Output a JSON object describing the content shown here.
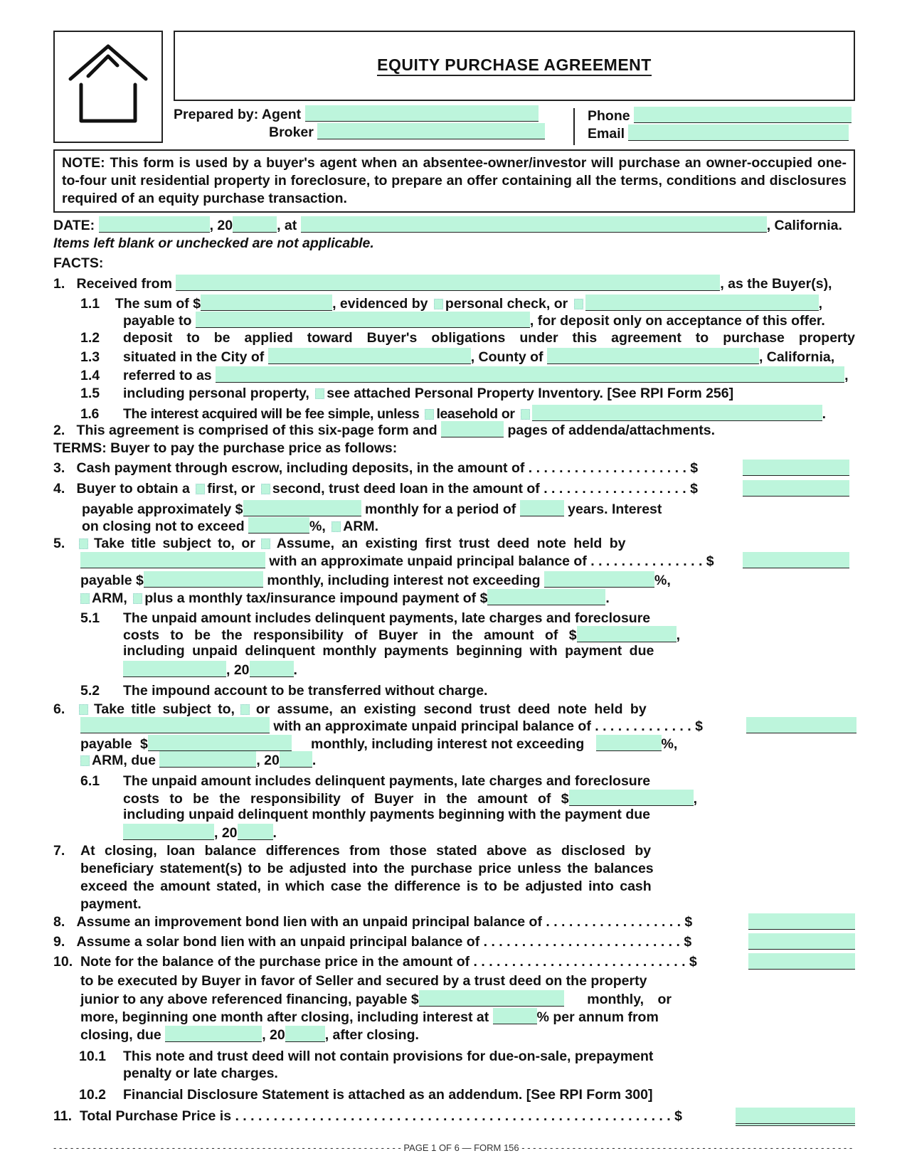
{
  "header": {
    "logo_icon": "house-icon",
    "title": "EQUITY PURCHASE AGREEMENT",
    "prepared_by_agent_label": "Prepared by: Agent",
    "broker_label": "Broker",
    "phone_label": "Phone",
    "email_label": "Email"
  },
  "note": "NOTE: This form is used by a buyer's agent when an absentee-owner/investor will purchase an owner-occupied one-to-four unit residential property in foreclosure, to prepare an offer containing all the terms, conditions and disclosures required of an equity purchase transaction.",
  "date_line": {
    "date_label": "DATE:",
    "year_prefix": ", 20",
    "at_label": ", at",
    "state": ", California."
  },
  "blank_notice": "Items left blank or unchecked are not applicable.",
  "facts_heading": "FACTS:",
  "items": {
    "i1": {
      "num": "1.",
      "text": "Received from",
      "suffix": ", as the Buyer(s),"
    },
    "i1_1": {
      "num": "1.1",
      "a": "The sum of $",
      "b": ", evidenced by",
      "c": "personal check, or",
      "d": ","
    },
    "i1_1b": {
      "a": "payable to",
      "b": ", for deposit only on acceptance of this offer."
    },
    "i1_2": {
      "num": "1.2",
      "text": "deposit to be applied toward Buyer's obligations under this agreement to purchase property"
    },
    "i1_3": {
      "num": "1.3",
      "a": "situated in the City of",
      "b": ", County of",
      "c": ", California,"
    },
    "i1_4": {
      "num": "1.4",
      "a": "referred to as",
      "b": ","
    },
    "i1_5": {
      "num": "1.5",
      "a": "including personal property,",
      "b": "see attached Personal Property Inventory. [See RPI Form 256]"
    },
    "i1_6": {
      "num": "1.6",
      "a": "The interest acquired will be fee simple, unless",
      "b": "leasehold or",
      "c": "."
    },
    "i2": {
      "num": "2.",
      "a": "This agreement is comprised of this six-page form and",
      "b": "pages of addenda/attachments."
    },
    "terms_heading": "TERMS: Buyer to pay the purchase price as follows:",
    "i3": {
      "num": "3.",
      "text": "Cash payment through escrow, including deposits, in the amount of . . . . . . . . . . . . . . . . . . . . . $"
    },
    "i4": {
      "num": "4.",
      "a": "Buyer to obtain a",
      "b": "first, or",
      "c": "second, trust deed loan in the amount of . . . . . . . . . . . . . . . . . . . $"
    },
    "i4b": {
      "a": "payable approximately $",
      "b": "monthly for a period of",
      "c": "years. Interest"
    },
    "i4c": {
      "a": "on closing not to exceed",
      "b": "%,",
      "c": "ARM."
    },
    "i5": {
      "num": "5.",
      "a": "Take title subject to, or",
      "b": "Assume, an existing first trust deed note held by"
    },
    "i5b": {
      "a": "with an approximate unpaid principal balance of . . . . . . . . . . . . . . . $"
    },
    "i5c": {
      "a": "payable $",
      "b": "monthly, including interest not exceeding",
      "c": "%,"
    },
    "i5d": {
      "a": "ARM,",
      "b": "plus a monthly tax/insurance impound payment of $",
      "c": "."
    },
    "i5_1": {
      "num": "5.1",
      "l1": "The unpaid amount includes delinquent payments, late charges and foreclosure",
      "l2": "costs to be the responsibility of Buyer in the amount of $",
      "l2end": ",",
      "l3": "including unpaid delinquent monthly payments beginning with payment due",
      "l4a": ", 20",
      "l4b": "."
    },
    "i5_2": {
      "num": "5.2",
      "text": "The impound account to be transferred without charge."
    },
    "i6": {
      "num": "6.",
      "a": "Take title subject to,",
      "b": "or assume, an existing second trust deed note held by"
    },
    "i6b": {
      "a": "with an approximate unpaid principal balance of . . . . . . . . . . . . . $"
    },
    "i6c": {
      "a": "payable $",
      "b": "monthly, including interest not exceeding",
      "c": "%,"
    },
    "i6d": {
      "a": "ARM, due",
      "b": ", 20",
      "c": "."
    },
    "i6_1": {
      "num": "6.1",
      "l1": "The unpaid amount includes delinquent payments, late charges and foreclosure",
      "l2": "costs to be the responsibility of Buyer in the amount of $",
      "l2end": ",",
      "l3": "including unpaid delinquent monthly payments beginning with the payment due",
      "l4a": ", 20",
      "l4b": "."
    },
    "i7": {
      "num": "7.",
      "l1": "At closing, loan balance differences from those stated above as disclosed by",
      "l2": "beneficiary statement(s) to be adjusted into the purchase price unless the balances",
      "l3": "exceed the amount stated, in which case the difference is to be adjusted into cash",
      "l4": "payment."
    },
    "i8": {
      "num": "8.",
      "text": "Assume an improvement bond lien with an unpaid principal balance of . . . . . . . . . . . . . . . . . . $"
    },
    "i9": {
      "num": "9.",
      "text": "Assume a solar bond lien with an unpaid principal balance of . . . . . . . . . . . . . . . . . . . . . . . . . . $"
    },
    "i10": {
      "num": "10.",
      "text": "Note for the balance of the purchase price in the amount of . . . . . . . . . . . . . . . . . . . . . . . . . . . .  $"
    },
    "i10b": {
      "l1": "to be executed by Buyer in favor of Seller and secured by a trust deed on the property",
      "l2a": "junior to any above referenced financing, payable $",
      "l2b": "monthly, or",
      "l3a": "more, beginning one month after closing, including interest at",
      "l3b": "% per annum from",
      "l4a": "closing, due",
      "l4b": ", 20",
      "l4c": ", after closing."
    },
    "i10_1": {
      "num": "10.1",
      "l1": "This note and trust deed will not contain provisions for due-on-sale, prepayment",
      "l2": "penalty or late charges."
    },
    "i10_2": {
      "num": "10.2",
      "text": "Financial Disclosure Statement is attached as an addendum. [See RPI Form 300]"
    },
    "i11": {
      "num": "11.",
      "text": "Total Purchase Price is . . . . . . . . . . . . . . . . . . . . . . . . . . . . . . . . . . . . . . . . . . . . . . . . . . . . . . . . . $"
    }
  },
  "footer": "- - - - - - - - - - - - - - - - - - - - - - - - - - - - - - - - - - - - - - - - - - - - - - - - - - - - - - - - - - - - - - PAGE 1 OF 6 — FORM 156 - - - - - - - - - - - - - - - - - - - - - - - - - - - - - - - - - - - - - - - - - - - - - - - - - - - - - - - - - - - - - - - - - - - - - - - - - -",
  "colors": {
    "field_fill": "#bdf5dc",
    "text": "#111111",
    "border": "#222222"
  }
}
